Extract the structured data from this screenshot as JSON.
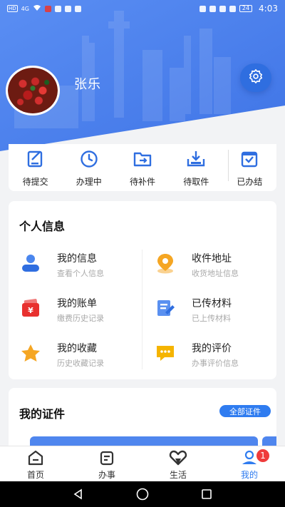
{
  "status_bar": {
    "left_indicators": [
      "HD",
      "4G",
      "wifi-icon",
      "recording-icon",
      "shield-icon",
      "bag-icon",
      "chat-icon"
    ],
    "right_indicators": [
      "headset-icon",
      "eye-icon",
      "nfc-icon",
      "vibrate-icon",
      "battery-icon"
    ],
    "battery": "24",
    "time": "4:03"
  },
  "profile": {
    "name": "张乐",
    "avatar": "avatar-berries-photo"
  },
  "status_items": [
    {
      "label": "待提交",
      "icon": "draft-edit-icon"
    },
    {
      "label": "办理中",
      "icon": "clock-icon"
    },
    {
      "label": "待补件",
      "icon": "folder-arrow-icon"
    },
    {
      "label": "待取件",
      "icon": "download-tray-icon"
    },
    {
      "label": "已办结",
      "icon": "checked-box-icon"
    }
  ],
  "personal_info": {
    "title": "个人信息",
    "items": [
      {
        "title": "我的信息",
        "sub": "查看个人信息",
        "icon": "person-icon"
      },
      {
        "title": "收件地址",
        "sub": "收货地址信息",
        "icon": "location-pin-icon"
      },
      {
        "title": "我的账单",
        "sub": "缴费历史记录",
        "icon": "wallet-yen-icon"
      },
      {
        "title": "已传材料",
        "sub": "已上传材料",
        "icon": "document-upload-icon"
      },
      {
        "title": "我的收藏",
        "sub": "历史收藏记录",
        "icon": "star-icon"
      },
      {
        "title": "我的评价",
        "sub": "办事评价信息",
        "icon": "comment-bubble-icon"
      }
    ]
  },
  "certificates": {
    "title": "我的证件",
    "all_label": "全部证件"
  },
  "bottom_nav": {
    "items": [
      {
        "label": "首页",
        "icon": "home-icon"
      },
      {
        "label": "办事",
        "icon": "task-icon"
      },
      {
        "label": "生活",
        "icon": "heart-icon"
      },
      {
        "label": "我的",
        "icon": "profile-icon"
      }
    ],
    "badge": "1",
    "active": "我的"
  },
  "colors": {
    "primary": "#2f7cf0",
    "header_blue": "#4a80ef",
    "badge_red": "#ef3b3b",
    "orange": "#f5a623",
    "red": "#e8312f"
  }
}
